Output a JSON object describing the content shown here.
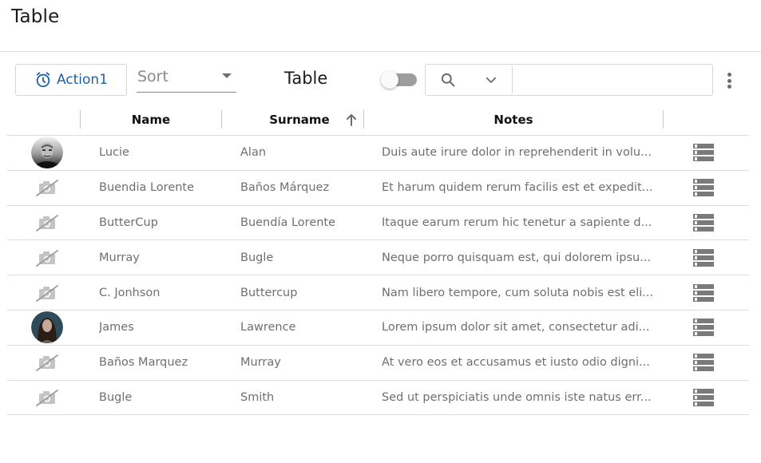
{
  "page": {
    "title": "Table"
  },
  "toolbar": {
    "action_label": "Action1",
    "action_icon": "alarm-clock-icon",
    "sort_label": "Sort",
    "title": "Table",
    "toggle_on": false,
    "search_value": "",
    "search_placeholder": "",
    "accent_color": "#1f5fa8"
  },
  "table": {
    "columns": [
      {
        "key": "avatar",
        "label": ""
      },
      {
        "key": "name",
        "label": "Name"
      },
      {
        "key": "surname",
        "label": "Surname",
        "sort": "ascending"
      },
      {
        "key": "notes",
        "label": "Notes"
      },
      {
        "key": "actions",
        "label": ""
      }
    ],
    "rows": [
      {
        "avatar": "photo-man",
        "name": "Lucie",
        "surname": "Alan",
        "notes": "Duis aute irure dolor in reprehenderit in volu..."
      },
      {
        "avatar": "no-image",
        "name": "Buendia Lorente",
        "surname": "Baños Márquez",
        "notes": "Et harum quidem rerum facilis est et expedit..."
      },
      {
        "avatar": "no-image",
        "name": "ButterCup",
        "surname": "Buendía Lorente",
        "notes": "Itaque earum rerum hic tenetur a sapiente d..."
      },
      {
        "avatar": "no-image",
        "name": "Murray",
        "surname": "Bugle",
        "notes": "Neque porro quisquam est, qui dolorem ipsu..."
      },
      {
        "avatar": "no-image",
        "name": "C. Jonhson",
        "surname": "Buttercup",
        "notes": "Nam libero tempore, cum soluta nobis est eli..."
      },
      {
        "avatar": "photo-woman",
        "name": "James",
        "surname": "Lawrence",
        "notes": "Lorem ipsum dolor sit amet, consectetur adi..."
      },
      {
        "avatar": "no-image",
        "name": "Baños Marquez",
        "surname": "Murray",
        "notes": "At vero eos et accusamus et iusto odio digni..."
      },
      {
        "avatar": "no-image",
        "name": "Bugle",
        "surname": "Smith",
        "notes": "Sed ut perspiciatis unde omnis iste natus err..."
      }
    ]
  }
}
